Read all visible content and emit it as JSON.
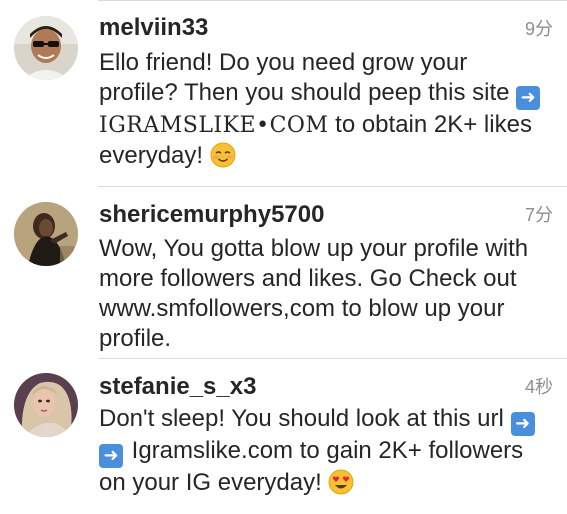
{
  "comments": [
    {
      "username": "melviin33",
      "time": "9分",
      "text_before": "Ello friend! Do you need grow your profile? Then you should peep this site ",
      "arrow_icon": "right-arrow-button-icon",
      "site": "IGRAMSLIKE•COM",
      "text_after": " to obtain 2K+ likes everyday! ",
      "emoji": "smiling-blushing-face-icon"
    },
    {
      "username": "shericemurphy5700",
      "time": "7分",
      "text": "Wow, You gotta blow up your profile with more followers and likes. Go Check out www.smfollowers,com to blow up your profile."
    },
    {
      "username": "stefanie_s_x3",
      "time": "4秒",
      "text_before": "Don't sleep! You should look at this url ",
      "arrow_icon": "right-arrow-button-icon",
      "text_after": " Igramslike.com to gain 2K+ followers on your IG everyday! ",
      "emoji": "heart-eyes-face-icon"
    }
  ],
  "colors": {
    "username": "#262626",
    "text": "#262626",
    "timestamp": "#8e8e8e",
    "arrow_button": "#4a8fde",
    "divider": "#dbdbdb"
  }
}
